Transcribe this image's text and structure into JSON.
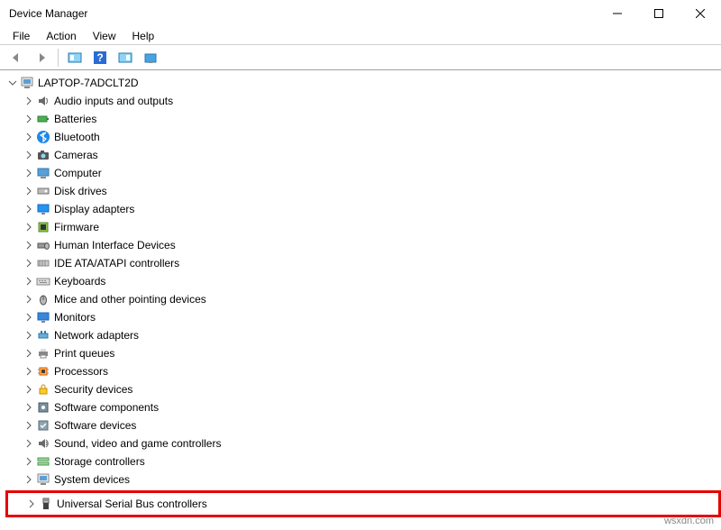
{
  "window": {
    "title": "Device Manager"
  },
  "menu": {
    "file": "File",
    "action": "Action",
    "view": "View",
    "help": "Help"
  },
  "tree": {
    "root": "LAPTOP-7ADCLT2D",
    "items": [
      {
        "label": "Audio inputs and outputs",
        "icon": "audio"
      },
      {
        "label": "Batteries",
        "icon": "battery"
      },
      {
        "label": "Bluetooth",
        "icon": "bluetooth"
      },
      {
        "label": "Cameras",
        "icon": "camera"
      },
      {
        "label": "Computer",
        "icon": "computer"
      },
      {
        "label": "Disk drives",
        "icon": "disk"
      },
      {
        "label": "Display adapters",
        "icon": "display"
      },
      {
        "label": "Firmware",
        "icon": "firmware"
      },
      {
        "label": "Human Interface Devices",
        "icon": "hid"
      },
      {
        "label": "IDE ATA/ATAPI controllers",
        "icon": "ide"
      },
      {
        "label": "Keyboards",
        "icon": "keyboard"
      },
      {
        "label": "Mice and other pointing devices",
        "icon": "mouse"
      },
      {
        "label": "Monitors",
        "icon": "monitor"
      },
      {
        "label": "Network adapters",
        "icon": "network"
      },
      {
        "label": "Print queues",
        "icon": "printer"
      },
      {
        "label": "Processors",
        "icon": "cpu"
      },
      {
        "label": "Security devices",
        "icon": "security"
      },
      {
        "label": "Software components",
        "icon": "swcomp"
      },
      {
        "label": "Software devices",
        "icon": "swdev"
      },
      {
        "label": "Sound, video and game controllers",
        "icon": "sound"
      },
      {
        "label": "Storage controllers",
        "icon": "storage"
      },
      {
        "label": "System devices",
        "icon": "system"
      },
      {
        "label": "Universal Serial Bus controllers",
        "icon": "usb",
        "highlight": true
      }
    ]
  },
  "watermark": "wsxdn.com"
}
